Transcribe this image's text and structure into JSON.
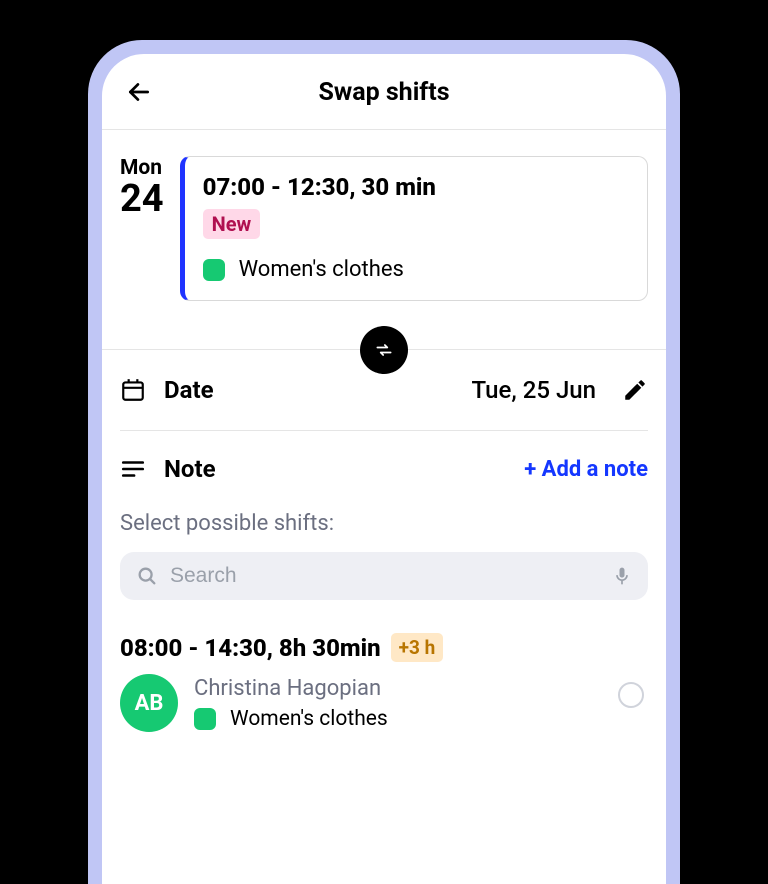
{
  "header": {
    "title": "Swap shifts"
  },
  "current": {
    "dow": "Mon",
    "day": "24",
    "time": "07:00 - 12:30, 30 min",
    "badge": "New",
    "dept": "Women's clothes"
  },
  "date_row": {
    "label": "Date",
    "value": "Tue, 25 Jun"
  },
  "note_row": {
    "label": "Note",
    "add": "+ Add a note"
  },
  "select_label": "Select possible shifts:",
  "search": {
    "placeholder": "Search"
  },
  "option": {
    "time": "08:00 - 14:30, 8h 30min",
    "delta": "+3 h",
    "initials": "AB",
    "name": "Christina Hagopian",
    "dept": "Women's clothes"
  }
}
